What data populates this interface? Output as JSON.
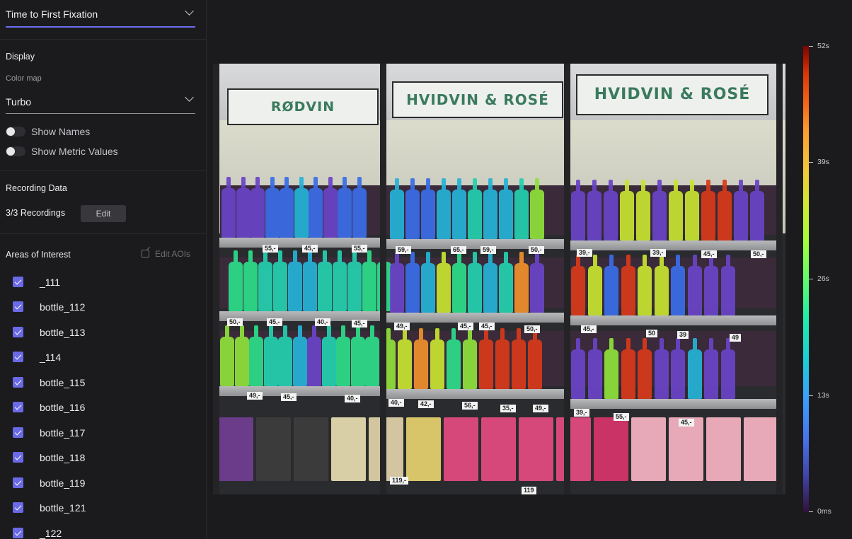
{
  "metric_select": {
    "value": "Time to First Fixation"
  },
  "display": {
    "title": "Display",
    "color_map_label": "Color map",
    "color_map_value": "Turbo",
    "toggles": [
      {
        "label": "Show Names",
        "on": false
      },
      {
        "label": "Show Metric Values",
        "on": false
      }
    ]
  },
  "recording": {
    "title": "Recording Data",
    "count": "3/3 Recordings",
    "edit_label": "Edit"
  },
  "aois": {
    "title": "Areas of Interest",
    "edit_label": "Edit AOIs",
    "items": [
      {
        "name": "_111",
        "checked": true
      },
      {
        "name": "bottle_112",
        "checked": true
      },
      {
        "name": "bottle_113",
        "checked": true
      },
      {
        "name": "_114",
        "checked": true
      },
      {
        "name": "bottle_115",
        "checked": true
      },
      {
        "name": "bottle_116",
        "checked": true
      },
      {
        "name": "bottle_117",
        "checked": true
      },
      {
        "name": "bottle_118",
        "checked": true
      },
      {
        "name": "bottle_119",
        "checked": true
      },
      {
        "name": "bottle_121",
        "checked": true
      },
      {
        "name": "_122",
        "checked": true
      }
    ]
  },
  "stimulus": {
    "signs": [
      "RØDVIN",
      "HVIDVIN & ROSÉ",
      "HVIDVIN & ROSÉ"
    ],
    "prices": [
      "55,-",
      "45,-",
      "55,-",
      "59,-",
      "65,-",
      "59,-",
      "50,-",
      "39,-",
      "39,-",
      "45,-",
      "50,-",
      "50,-",
      "45,-",
      "40,-",
      "45,-",
      "49,-",
      "45,-",
      "45,-",
      "50,-",
      "45,-",
      "50",
      "39",
      "49",
      "49,-",
      "45,-",
      "40,-",
      "40,-",
      "42,-",
      "56,-",
      "35,-",
      "49,-",
      "39,-",
      "55,-",
      "45,-",
      "119,-",
      "119"
    ]
  },
  "legend": {
    "colormap": "turbo",
    "labels": [
      "52s",
      "39s",
      "26s",
      "13s",
      "0ms"
    ]
  },
  "colors": {
    "accent": "#6c6cf0",
    "checkbox": "#6a6ae8",
    "background": "#1b1b1d"
  }
}
